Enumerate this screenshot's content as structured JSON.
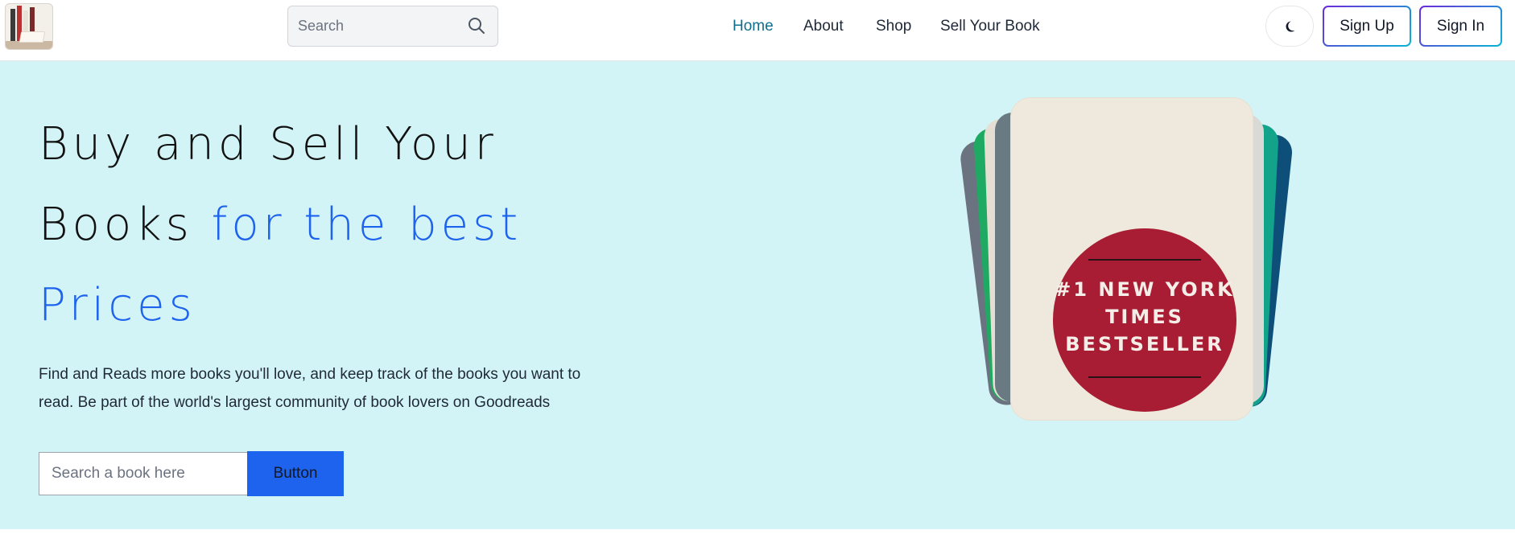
{
  "header": {
    "logo_icon": "books-logo-icon",
    "search": {
      "placeholder": "Search",
      "icon": "search-icon"
    },
    "nav": [
      {
        "label": "Home",
        "active": true
      },
      {
        "label": "About",
        "active": false
      },
      {
        "label": "Shop",
        "active": false
      },
      {
        "label": "Sell Your Book",
        "active": false
      }
    ],
    "theme_toggle_icon": "moon-icon",
    "sign_up_label": "Sign Up",
    "sign_in_label": "Sign In"
  },
  "hero": {
    "headline_line1": "Buy and Sell Your",
    "headline_line2_dark": "Books ",
    "headline_line2_blue": "for the best",
    "headline_line3_blue": "Prices",
    "description_line1": "Find and Reads more books you'll love, and keep track of the books you want to",
    "description_line2": "read. Be part of the world's largest community of book lovers on Goodreads",
    "search_placeholder": "Search a book here",
    "button_label": "Button",
    "featured_book": {
      "seal_line1": "#1 NEW YORK",
      "seal_line2": "TIMES",
      "seal_line3": "BESTSELLER"
    }
  },
  "colors": {
    "accent_blue": "#1d63ed",
    "hero_background": "#d3f4f6",
    "nav_active": "#0f6e8c",
    "seal_red": "#a81d33"
  }
}
